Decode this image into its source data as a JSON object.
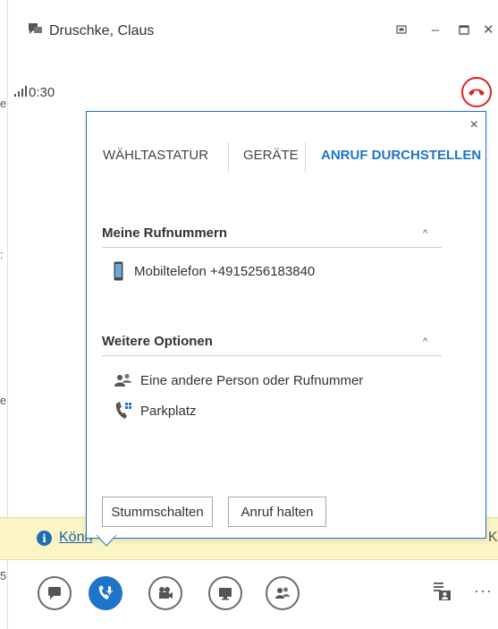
{
  "window": {
    "title": "Druschke, Claus",
    "restore_icon": "restore-icon",
    "minimize_label": "–",
    "maximize_icon": "maximize-icon",
    "close_label": "✕"
  },
  "call": {
    "duration": "0:30",
    "hangup_color": "#e02020"
  },
  "left_edge": [
    "e",
    ":",
    "e",
    "5"
  ],
  "popup": {
    "close_label": "×",
    "tabs": [
      {
        "label": "WÄHLTASTATUR",
        "active": false
      },
      {
        "label": "GERÄTE",
        "active": false
      },
      {
        "label": "ANRUF DURCHSTELLEN",
        "active": true
      }
    ],
    "sections": [
      {
        "title": "Meine Rufnummern",
        "items": [
          {
            "icon": "mobile-phone-icon",
            "text": "Mobiltelefon +4915256183840"
          }
        ]
      },
      {
        "title": "Weitere Optionen",
        "items": [
          {
            "icon": "people-icon",
            "text": "Eine andere Person oder Rufnummer"
          },
          {
            "icon": "park-call-icon",
            "text": "Parkplatz"
          }
        ]
      }
    ],
    "buttons": {
      "mute": "Stummschalten",
      "hold": "Anruf halten"
    }
  },
  "notification": {
    "text": "Könn",
    "right_glyph": "K"
  },
  "toolbar": {
    "items": [
      {
        "icon": "chat-icon",
        "active": false
      },
      {
        "icon": "call-controls-icon",
        "active": true
      },
      {
        "icon": "video-icon",
        "active": false
      },
      {
        "icon": "present-screen-icon",
        "active": false
      },
      {
        "icon": "participants-icon",
        "active": false
      }
    ],
    "accent": "#1e74c8",
    "more_label": "···"
  }
}
